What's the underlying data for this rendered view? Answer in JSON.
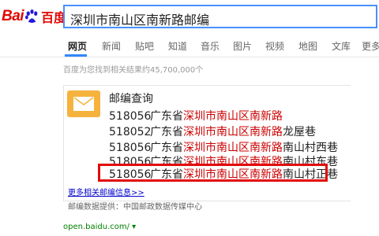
{
  "logo": {
    "bai": "Bai",
    "du": "百度"
  },
  "search": {
    "query": "深圳市南山区南新路邮编"
  },
  "tabs": [
    "网页",
    "新闻",
    "贴吧",
    "知道",
    "音乐",
    "图片",
    "视频",
    "地图",
    "文库",
    "更多»"
  ],
  "stats": "百度为您找到相关结果约45,700,000个",
  "card": {
    "title": "邮编查询",
    "rows": [
      {
        "pre": "",
        "hl": "深圳市南山区南新路",
        "post": "",
        "code": ""
      },
      {
        "code": "518052",
        "prov": "广东省",
        "hl": "深圳市南山区南新路",
        "post": "龙屋巷"
      },
      {
        "code": "518056",
        "prov": "广东省",
        "hl": "深圳市南山区南新路",
        "post": "南山村西巷"
      },
      {
        "code": "518056",
        "prov": "广东省",
        "hl": "深圳市南山区南新路",
        "post": "南山村东巷"
      },
      {
        "code": "518056",
        "prov": "广东省",
        "hl": "深圳市南山区南新路",
        "post": "南山村正巷"
      }
    ],
    "first_row": {
      "code": "518056",
      "prov": "广东省",
      "hl": "深圳市南山区南新路"
    },
    "more_link": "更多相关邮编信息>>",
    "provider": "邮编数据提供：中国邮政数据传媒中心"
  },
  "url": "open.baidu.com/ ▾",
  "colors": {
    "brand_red": "#e10601",
    "search_border": "#4791ff",
    "highlight": "#c00",
    "annotation_box": "#e10a0a",
    "icon_orange": "#f5b23c"
  }
}
